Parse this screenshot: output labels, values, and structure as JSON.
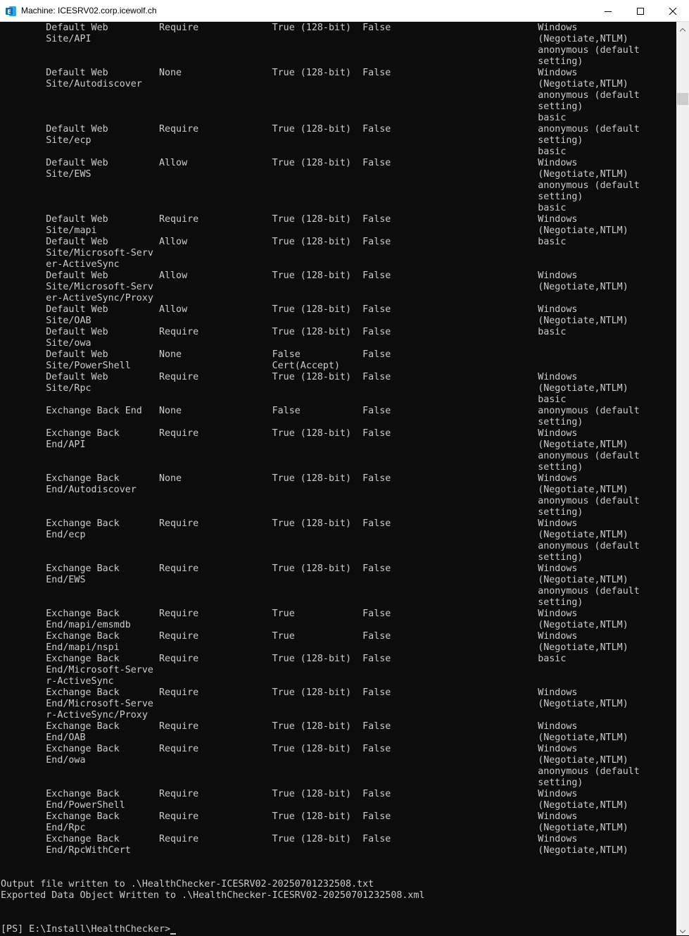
{
  "window": {
    "title": "Machine: ICESRV02.corp.icewolf.ch",
    "icon": "exchange-icon"
  },
  "console": {
    "lines": [
      "        Default Web         Require             True (128-bit)  False                          Windows",
      "        Site/API                                                                               (Negotiate,NTLM)",
      "                                                                                               anonymous (default",
      "                                                                                               setting)",
      "        Default Web         None                True (128-bit)  False                          Windows",
      "        Site/Autodiscover                                                                      (Negotiate,NTLM)",
      "                                                                                               anonymous (default",
      "                                                                                               setting)",
      "                                                                                               basic",
      "        Default Web         Require             True (128-bit)  False                          anonymous (default",
      "        Site/ecp                                                                               setting)",
      "                                                                                               basic",
      "        Default Web         Allow               True (128-bit)  False                          Windows",
      "        Site/EWS                                                                               (Negotiate,NTLM)",
      "                                                                                               anonymous (default",
      "                                                                                               setting)",
      "                                                                                               basic",
      "        Default Web         Require             True (128-bit)  False                          Windows",
      "        Site/mapi                                                                              (Negotiate,NTLM)",
      "        Default Web         Allow               True (128-bit)  False                          basic",
      "        Site/Microsoft-Serv",
      "        er-ActiveSync",
      "        Default Web         Allow               True (128-bit)  False                          Windows",
      "        Site/Microsoft-Serv                                                                    (Negotiate,NTLM)",
      "        er-ActiveSync/Proxy",
      "        Default Web         Allow               True (128-bit)  False                          Windows",
      "        Site/OAB                                                                               (Negotiate,NTLM)",
      "        Default Web         Require             True (128-bit)  False                          basic",
      "        Site/owa",
      "        Default Web         None                False           False",
      "        Site/PowerShell                         Cert(Accept)",
      "        Default Web         Require             True (128-bit)  False                          Windows",
      "        Site/Rpc                                                                               (Negotiate,NTLM)",
      "                                                                                               basic",
      "        Exchange Back End   None                False           False                          anonymous (default",
      "                                                                                               setting)",
      "        Exchange Back       Require             True (128-bit)  False                          Windows",
      "        End/API                                                                                (Negotiate,NTLM)",
      "                                                                                               anonymous (default",
      "                                                                                               setting)",
      "        Exchange Back       None                True (128-bit)  False                          Windows",
      "        End/Autodiscover                                                                       (Negotiate,NTLM)",
      "                                                                                               anonymous (default",
      "                                                                                               setting)",
      "        Exchange Back       Require             True (128-bit)  False                          Windows",
      "        End/ecp                                                                                (Negotiate,NTLM)",
      "                                                                                               anonymous (default",
      "                                                                                               setting)",
      "        Exchange Back       Require             True (128-bit)  False                          Windows",
      "        End/EWS                                                                                (Negotiate,NTLM)",
      "                                                                                               anonymous (default",
      "                                                                                               setting)",
      "        Exchange Back       Require             True            False                          Windows",
      "        End/mapi/emsmdb                                                                        (Negotiate,NTLM)",
      "        Exchange Back       Require             True            False                          Windows",
      "        End/mapi/nspi                                                                          (Negotiate,NTLM)",
      "        Exchange Back       Require             True (128-bit)  False                          basic",
      "        End/Microsoft-Serve",
      "        r-ActiveSync",
      "        Exchange Back       Require             True (128-bit)  False                          Windows",
      "        End/Microsoft-Serve                                                                    (Negotiate,NTLM)",
      "        r-ActiveSync/Proxy",
      "        Exchange Back       Require             True (128-bit)  False                          Windows",
      "        End/OAB                                                                                (Negotiate,NTLM)",
      "        Exchange Back       Require             True (128-bit)  False                          Windows",
      "        End/owa                                                                                (Negotiate,NTLM)",
      "                                                                                               anonymous (default",
      "                                                                                               setting)",
      "        Exchange Back       Require             True (128-bit)  False                          Windows",
      "        End/PowerShell                                                                         (Negotiate,NTLM)",
      "        Exchange Back       Require             True (128-bit)  False                          Windows",
      "        End/Rpc                                                                                (Negotiate,NTLM)",
      "        Exchange Back       Require             True (128-bit)  False                          Windows",
      "        End/RpcWithCert                                                                        (Negotiate,NTLM)",
      "",
      "",
      "Output file written to .\\HealthChecker-ICESRV02-20250701232508.txt",
      "Exported Data Object Written to .\\HealthChecker-ICESRV02-20250701232508.xml",
      "",
      ""
    ],
    "prompt": "[PS] E:\\Install\\HealthChecker>"
  },
  "colors": {
    "console_bg": "#0c0c0c",
    "console_fg": "#cccccc",
    "titlebar_bg": "#ffffff",
    "exchange_blue": "#0f6cbd"
  }
}
